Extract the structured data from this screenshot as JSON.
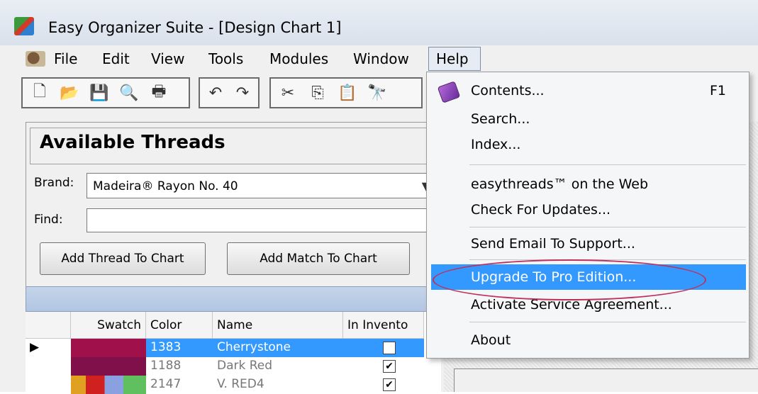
{
  "window": {
    "title": "Easy Organizer Suite - [Design Chart 1]",
    "icon": "app-icon"
  },
  "menubar": {
    "items": [
      "File",
      "Edit",
      "View",
      "Tools",
      "Modules",
      "Window",
      "Help"
    ],
    "active": "Help"
  },
  "toolbar": {
    "icons": [
      "new-icon",
      "open-icon",
      "save-icon",
      "print-preview-icon",
      "print-icon",
      "undo-icon",
      "redo-icon",
      "cut-icon",
      "copy-icon",
      "paste-icon",
      "find-icon"
    ]
  },
  "panel": {
    "title": "Available Threads",
    "brand_label": "Brand:",
    "brand_value": "Madeira® Rayon No. 40",
    "find_label": "Find:",
    "find_value": "",
    "add_thread_button": "Add Thread To Chart",
    "add_match_button": "Add Match To Chart"
  },
  "grid": {
    "columns": [
      "Swatch",
      "Color",
      "Name",
      "In Invento"
    ],
    "rows": [
      {
        "swatch_color": "#a0104a",
        "color": "1383",
        "name": "Cherrystone",
        "in_inventory": false,
        "selected": true
      },
      {
        "swatch_color": "#80104a",
        "color": "1188",
        "name": "Dark Red",
        "in_inventory": true,
        "selected": false
      },
      {
        "swatch_color": "#d03030",
        "color": "2147",
        "name": "V. RED4",
        "in_inventory": true,
        "selected": false
      }
    ]
  },
  "help_menu": {
    "items": [
      {
        "label": "Contents...",
        "shortcut": "F1",
        "icon": "help-book-icon"
      },
      {
        "label": "Search...",
        "shortcut": ""
      },
      {
        "label": "Index...",
        "shortcut": ""
      },
      {
        "label": "easythreads™ on the Web",
        "shortcut": ""
      },
      {
        "label": "Check For Updates...",
        "shortcut": ""
      },
      {
        "label": "Send Email To Support...",
        "shortcut": ""
      },
      {
        "label": "Upgrade To Pro Edition...",
        "shortcut": ""
      },
      {
        "label": "Activate Service Agreement...",
        "shortcut": ""
      },
      {
        "label": "About",
        "shortcut": ""
      }
    ],
    "highlighted": "Upgrade To Pro Edition...",
    "colors": {
      "highlight": "#3399ff",
      "annotation_ellipse": "#c0305a"
    }
  }
}
